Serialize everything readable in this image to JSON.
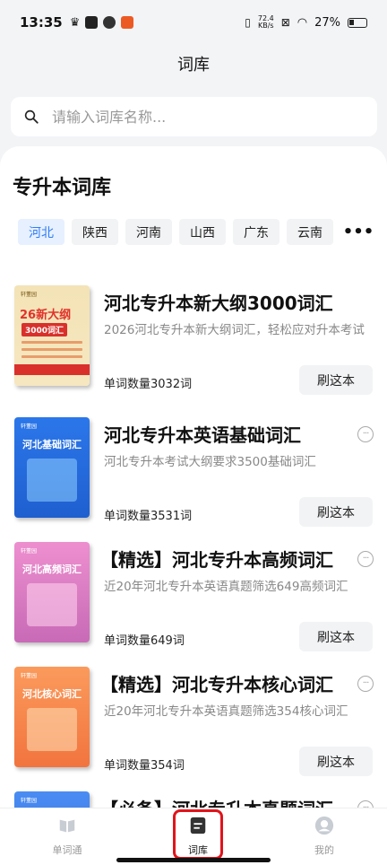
{
  "status_bar": {
    "time": "13:35",
    "net_speed_value": "72.4",
    "net_speed_unit": "KB/s",
    "battery": "27%"
  },
  "header": {
    "title": "词库"
  },
  "search": {
    "placeholder": "请输入词库名称..."
  },
  "section": {
    "title": "专升本词库"
  },
  "regions": [
    "河北",
    "陕西",
    "河南",
    "山西",
    "广东",
    "云南"
  ],
  "active_region": "河北",
  "books": [
    {
      "title": "河北专升本新大纲3000词汇",
      "desc": "2026河北专升本新大纲词汇，轻松应对升本考试",
      "count": "单词数量3032词",
      "button": "刷这本",
      "cover": {
        "brand": "轩董园",
        "big": "26新大纲",
        "sub": "3000词汇"
      }
    },
    {
      "title": "河北专升本英语基础词汇",
      "desc": "河北专升本考试大纲要求3500基础词汇",
      "count": "单词数量3531词",
      "button": "刷这本",
      "cover": {
        "brand": "轩董园",
        "title": "河北基础词汇"
      }
    },
    {
      "title": "【精选】河北专升本高频词汇",
      "desc": "近20年河北专升本英语真题筛选649高频词汇",
      "count": "单词数量649词",
      "button": "刷这本",
      "cover": {
        "brand": "轩董园",
        "title": "河北高频词汇"
      }
    },
    {
      "title": "【精选】河北专升本核心词汇",
      "desc": "近20年河北专升本英语真题筛选354核心词汇",
      "count": "单词数量354词",
      "button": "刷这本",
      "cover": {
        "brand": "轩董园",
        "title": "河北核心词汇"
      }
    },
    {
      "title": "【必备】河北专升本真题词汇",
      "cover": {
        "brand": "轩董园"
      }
    }
  ],
  "tabs": [
    {
      "label": "单词通",
      "icon": "book-icon"
    },
    {
      "label": "词库",
      "icon": "wordbank-icon"
    },
    {
      "label": "我的",
      "icon": "profile-icon"
    }
  ],
  "active_tab": "词库"
}
